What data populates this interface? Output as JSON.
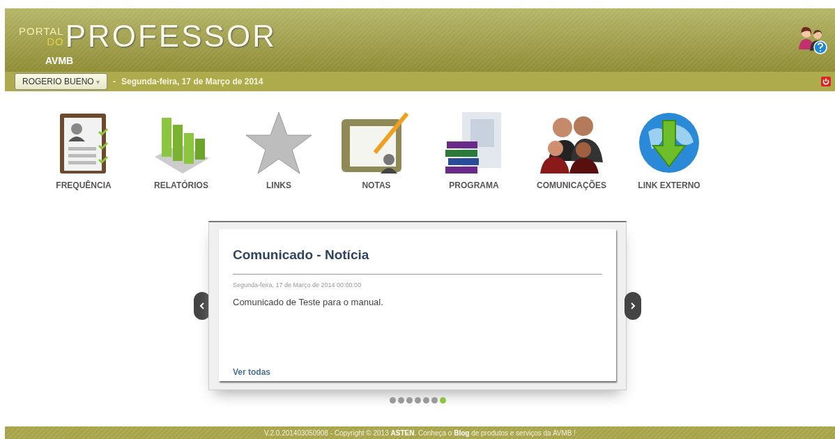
{
  "header": {
    "logo": {
      "small_top": "PORTAL",
      "small_bottom": "DO",
      "big": "PROFESSOR"
    },
    "subtitle": "AVMB"
  },
  "user_menu": {
    "label": "ROGERIO BUENO",
    "caret": "▾"
  },
  "date_bar": {
    "separator": "-",
    "date": "Segunda-feira, 17 de Março de 2014"
  },
  "menu": [
    {
      "kind": "attendance",
      "label": "FREQUÊNCIA"
    },
    {
      "kind": "reports",
      "label": "RELATÓRIOS"
    },
    {
      "kind": "links",
      "label": "LINKS"
    },
    {
      "kind": "grades",
      "label": "NOTAS"
    },
    {
      "kind": "program",
      "label": "PROGRAMA"
    },
    {
      "kind": "communications",
      "label": "COMUNICAÇÕES"
    },
    {
      "kind": "external",
      "label": "LINK EXTERNO"
    }
  ],
  "news": {
    "title": "Comunicado - Notícia",
    "timestamp": "Segunda-feira, 17 de Março de 2014 00:00:00",
    "body": "Comunicado de Teste para o manual.",
    "link": "Ver todas"
  },
  "pager": [
    {
      "selected": false
    },
    {
      "selected": false
    },
    {
      "selected": false
    },
    {
      "selected": false
    },
    {
      "selected": false
    },
    {
      "selected": false
    },
    {
      "selected": true
    }
  ],
  "footer": "V.2.0.201403050908 - Copyright © 2013 **ASTEN**. Conheça o **Blog** de produtos e serviços da AVMB !"
}
